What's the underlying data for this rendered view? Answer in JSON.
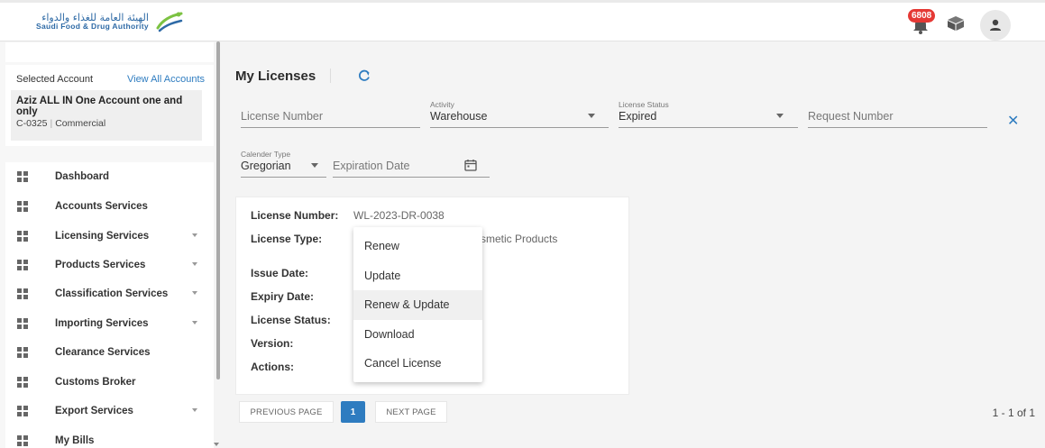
{
  "header": {
    "logo_ar": "الهيئة العامة للغذاء والدواء",
    "logo_en": "Saudi Food & Drug Authority",
    "notification_count": "6808"
  },
  "account": {
    "selected_label": "Selected Account",
    "view_all_label": "View All Accounts",
    "name": "Aziz ALL IN One Account one and only",
    "code": "C-0325",
    "type": "Commercial"
  },
  "menu": {
    "items": [
      {
        "label": "Dashboard"
      },
      {
        "label": "Accounts Services"
      },
      {
        "label": "Licensing Services"
      },
      {
        "label": "Products Services"
      },
      {
        "label": "Classification Services"
      },
      {
        "label": "Importing Services"
      },
      {
        "label": "Clearance Services"
      },
      {
        "label": "Customs Broker"
      },
      {
        "label": "Export Services"
      },
      {
        "label": "My Bills"
      }
    ]
  },
  "page": {
    "title": "My Licenses"
  },
  "filters": {
    "license_number_placeholder": "License Number",
    "activity_label": "Activity",
    "activity_value": "Warehouse",
    "status_label": "License Status",
    "status_value": "Expired",
    "request_number_placeholder": "Request Number",
    "calendar_label": "Calender Type",
    "calendar_value": "Gregorian",
    "expiration_placeholder": "Expiration Date"
  },
  "license": {
    "labels": {
      "number": "License Number:",
      "type": "License Type:",
      "issue": "Issue Date:",
      "expiry": "Expiry Date:",
      "status": "License Status:",
      "version": "Version:",
      "actions": "Actions:"
    },
    "number_value": "WL-2023-DR-0038",
    "type_value_visible": "smetic Products"
  },
  "actions_menu": {
    "items": [
      "Renew",
      "Update",
      "Renew & Update",
      "Download",
      "Cancel License"
    ]
  },
  "pagination": {
    "prev": "PREVIOUS PAGE",
    "current": "1",
    "next": "NEXT PAGE",
    "count": "1 - 1 of 1"
  },
  "colors": {
    "accent": "#2e7cc0",
    "badge": "#e53935"
  }
}
